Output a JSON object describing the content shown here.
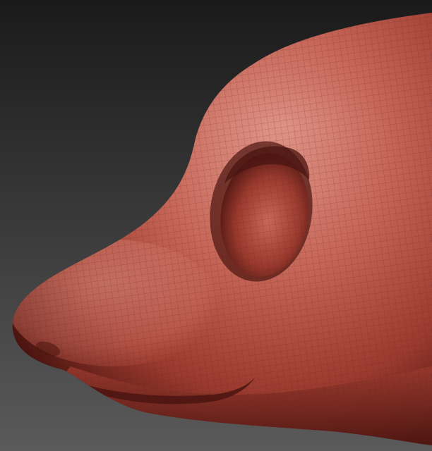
{
  "scene": {
    "subject": "sculpted-head-mesh",
    "colors": {
      "background_top": "#1a1a1a",
      "background_bottom": "#5a5a5a",
      "clay_base": "#9a3a2e",
      "clay_light": "#c7685a",
      "clay_highlight": "#e0978a",
      "clay_shadow": "#4a1410",
      "wire_line": "#5a1c15"
    },
    "wireframe_visible": true
  }
}
